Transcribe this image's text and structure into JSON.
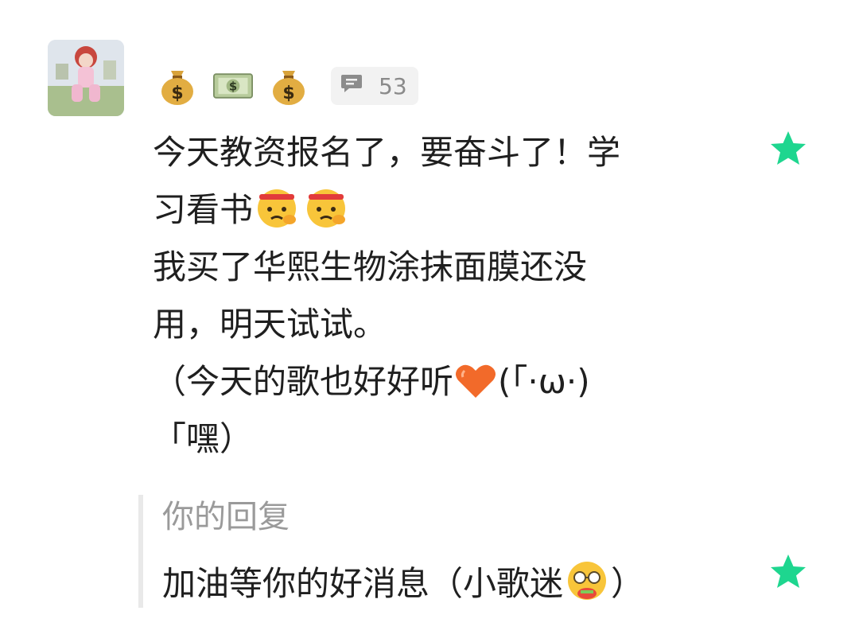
{
  "comment": {
    "avatar_icon": "user-avatar",
    "badges": [
      "money-bag-icon",
      "dollar-banknote-icon",
      "money-bag-icon"
    ],
    "comment_count": "53",
    "message_lines": [
      "今天教资报名了，要奋斗了！学",
      "习看书",
      "我买了华熙生物涂抹面膜还没",
      "用，明天试试。",
      "（今天的歌也好好听",
      "「嘿）"
    ],
    "line5_suffix": "(「·ω·)",
    "star_color": "#1ed68f"
  },
  "reply": {
    "label": "你的回复",
    "text": "加油等你的好消息（小歌迷",
    "text_suffix": "）"
  }
}
